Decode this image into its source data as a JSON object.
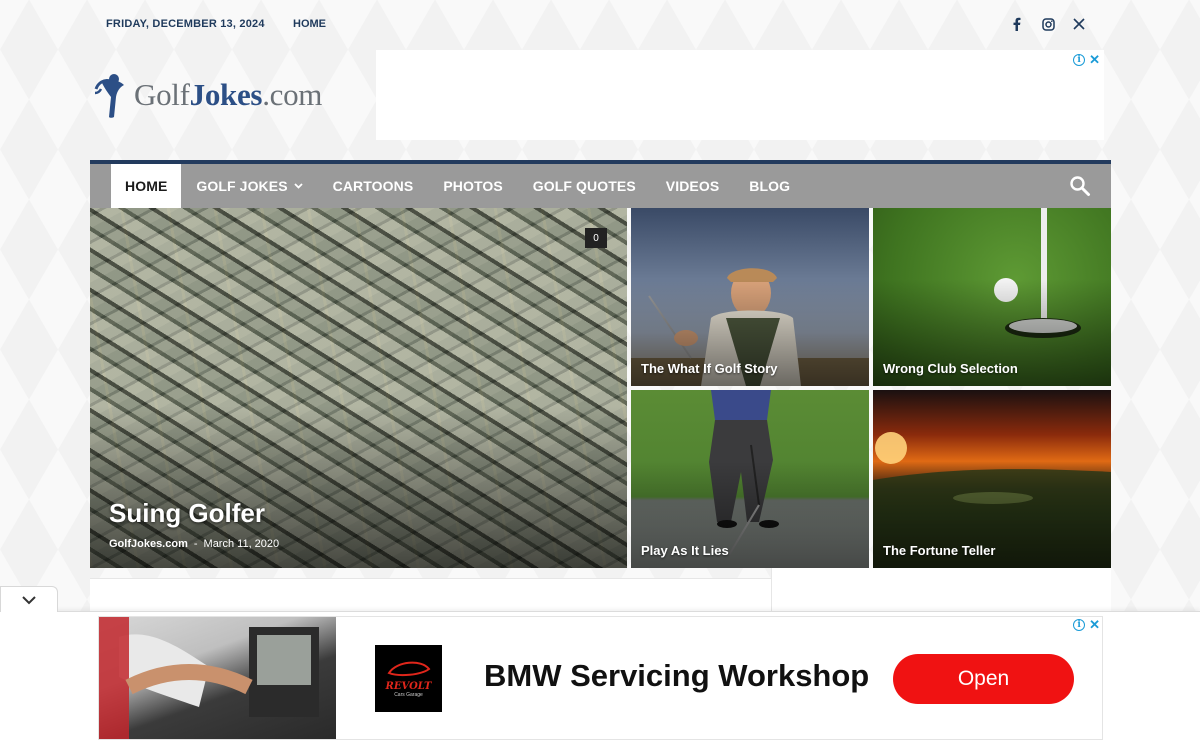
{
  "topbar": {
    "date": "FRIDAY, DECEMBER 13, 2024",
    "home_link": "HOME",
    "social": [
      "facebook-icon",
      "instagram-icon",
      "x-icon"
    ]
  },
  "logo": {
    "golf": "Golf",
    "jokes": "Jokes",
    "tld": ".com",
    "brand_color": "#2c4f86"
  },
  "nav": {
    "items": [
      {
        "label": "HOME",
        "active": true
      },
      {
        "label": "GOLF JOKES",
        "dropdown": true
      },
      {
        "label": "CARTOONS"
      },
      {
        "label": "PHOTOS"
      },
      {
        "label": "GOLF QUOTES"
      },
      {
        "label": "VIDEOS"
      },
      {
        "label": "BLOG"
      }
    ],
    "accent": "#233b5e"
  },
  "featured": {
    "main": {
      "title": "Suing Golfer",
      "author": "GolfJokes.com",
      "separator": "-",
      "date": "March 11, 2020",
      "comments": "0"
    },
    "tiles": [
      {
        "title": "The What If Golf Story"
      },
      {
        "title": "Wrong Club Selection"
      },
      {
        "title": "Play As It Lies"
      },
      {
        "title": "The Fortune Teller"
      }
    ]
  },
  "bottom_ad": {
    "headline": "BMW Servicing Workshop",
    "cta": "Open",
    "logo_text": "REVOLT",
    "logo_sub": "Cars Garage",
    "cta_color": "#f01212"
  }
}
